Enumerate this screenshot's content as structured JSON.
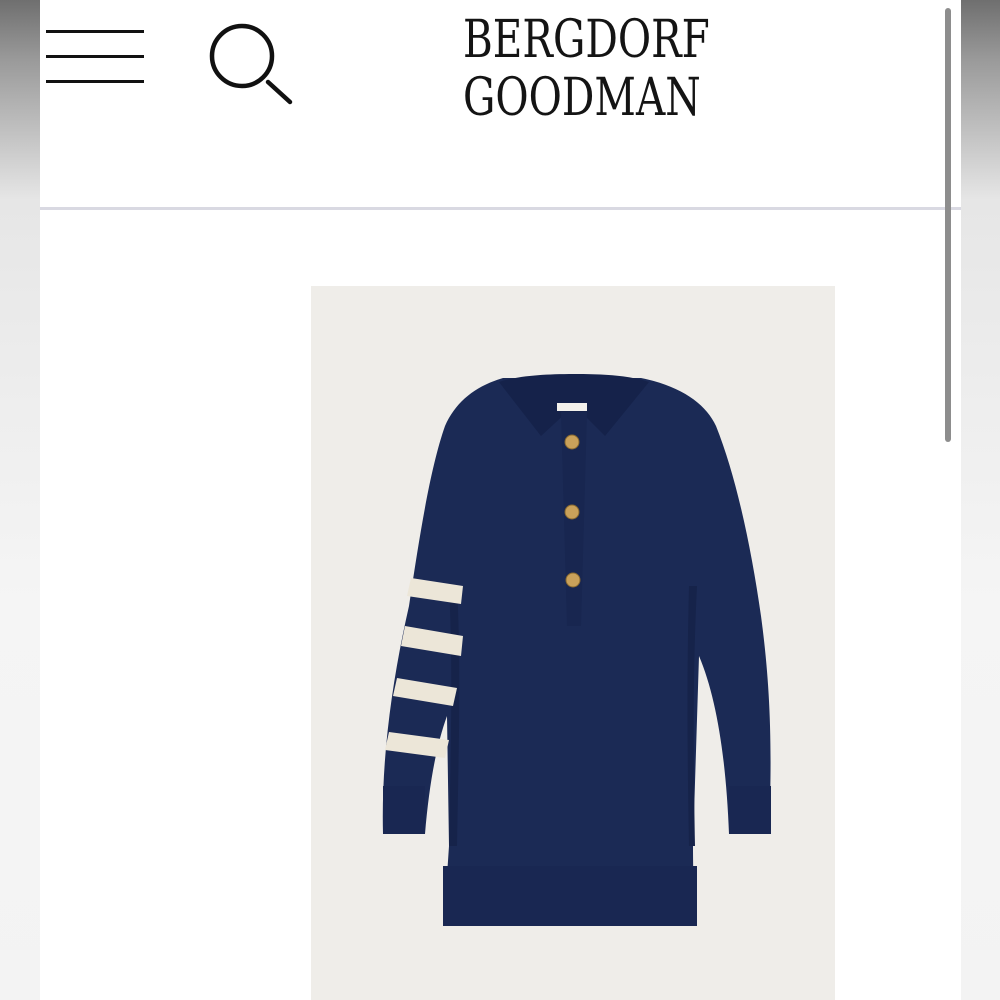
{
  "brand": {
    "line1": "BERGDORF",
    "line2": "GOODMAN"
  },
  "header": {
    "menu_icon": "hamburger-menu-icon",
    "search_icon": "search-icon"
  },
  "product": {
    "image_description_icon": "navy-polo-sweater-dress-image"
  },
  "colors": {
    "navy": "#1b2a55",
    "cream": "#ece6d8",
    "gold": "#c9a15a",
    "image_background": "#efede9",
    "divider": "#d9d9e2"
  }
}
